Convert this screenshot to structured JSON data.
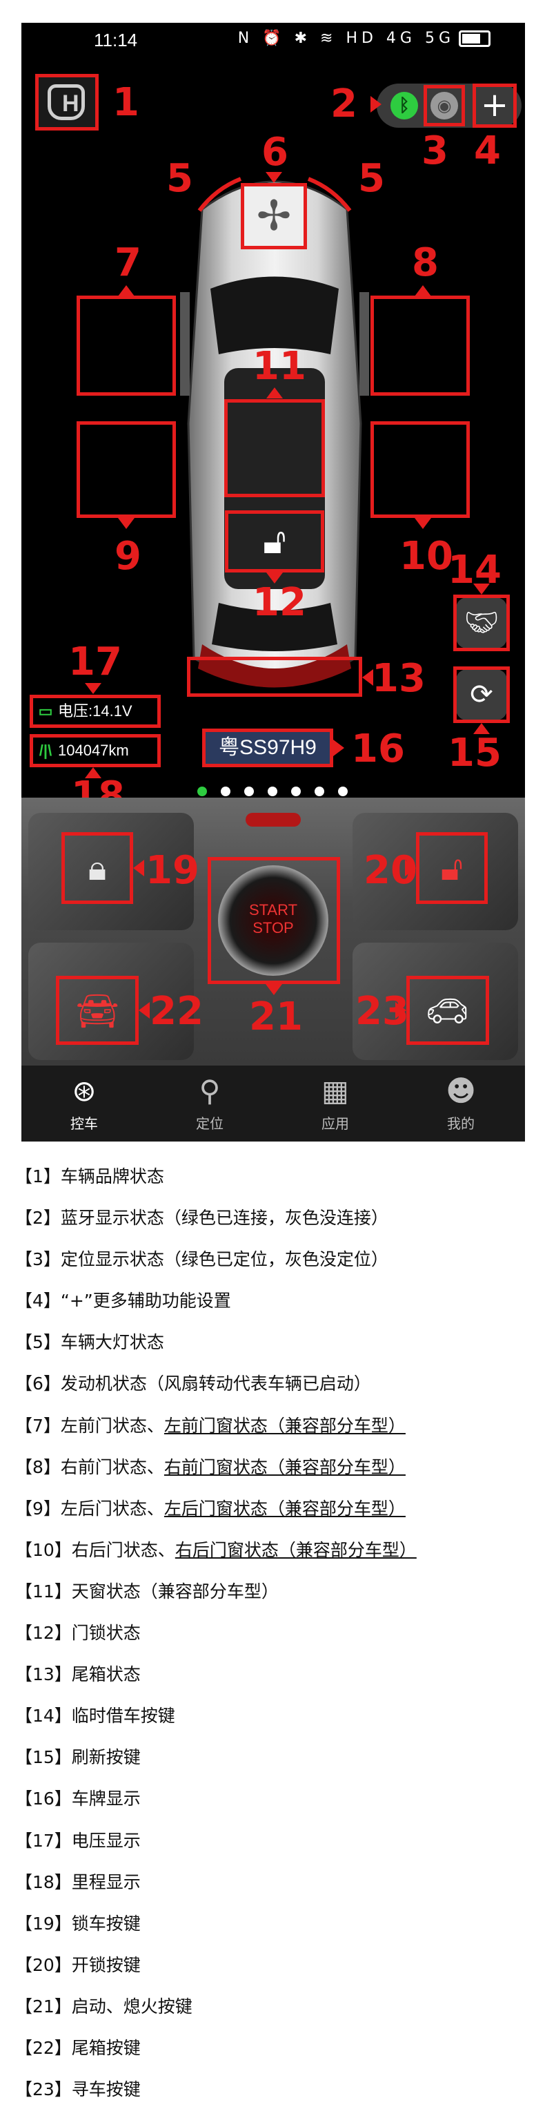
{
  "status_bar": {
    "time": "11:14",
    "icons_text": "N ⏰ ✱ ≋ HD 4G 5G"
  },
  "brand": {
    "logo_letter": "H"
  },
  "plate": "粤SS97H9",
  "voltage": "电压:14.1V",
  "mileage": "104047km",
  "start_button": {
    "line1": "START",
    "line2": "STOP"
  },
  "tabs": [
    {
      "label": "控车",
      "icon": "steering-wheel-icon"
    },
    {
      "label": "定位",
      "icon": "location-pin-icon"
    },
    {
      "label": "应用",
      "icon": "apps-grid-icon"
    },
    {
      "label": "我的",
      "icon": "person-icon"
    }
  ],
  "markers": [
    "1",
    "2",
    "3",
    "4",
    "5",
    "5",
    "6",
    "7",
    "8",
    "9",
    "10",
    "11",
    "12",
    "13",
    "14",
    "15",
    "16",
    "17",
    "18",
    "19",
    "20",
    "21",
    "22",
    "23"
  ],
  "legend": [
    {
      "text": "【1】车辆品牌状态"
    },
    {
      "text": "【2】蓝牙显示状态（绿色已连接，灰色没连接）"
    },
    {
      "text": "【3】定位显示状态（绿色已定位，灰色没定位）"
    },
    {
      "text": "【4】“+”更多辅助功能设置"
    },
    {
      "text": "【5】车辆大灯状态"
    },
    {
      "text": "【6】发动机状态（风扇转动代表车辆已启动）"
    },
    {
      "prefix": "【7】左前门状态、",
      "underlined": "左前门窗状态（兼容部分车型）"
    },
    {
      "prefix": "【8】右前门状态、",
      "underlined": "右前门窗状态（兼容部分车型）"
    },
    {
      "prefix": "【9】左后门状态、",
      "underlined": "左后门窗状态（兼容部分车型）"
    },
    {
      "prefix": "【10】右后门状态、",
      "underlined": "右后门窗状态（兼容部分车型）"
    },
    {
      "text": "【11】天窗状态（兼容部分车型）"
    },
    {
      "text": "【12】门锁状态"
    },
    {
      "text": "【13】尾箱状态"
    },
    {
      "text": "【14】临时借车按键"
    },
    {
      "text": "【15】刷新按键"
    },
    {
      "text": "【16】车牌显示"
    },
    {
      "text": "【17】电压显示"
    },
    {
      "text": "【18】里程显示"
    },
    {
      "text": "【19】锁车按键"
    },
    {
      "text": "【20】开锁按键"
    },
    {
      "text": "【21】启动、熄火按键"
    },
    {
      "text": "【22】尾箱按键"
    },
    {
      "text": "【23】寻车按键"
    }
  ]
}
